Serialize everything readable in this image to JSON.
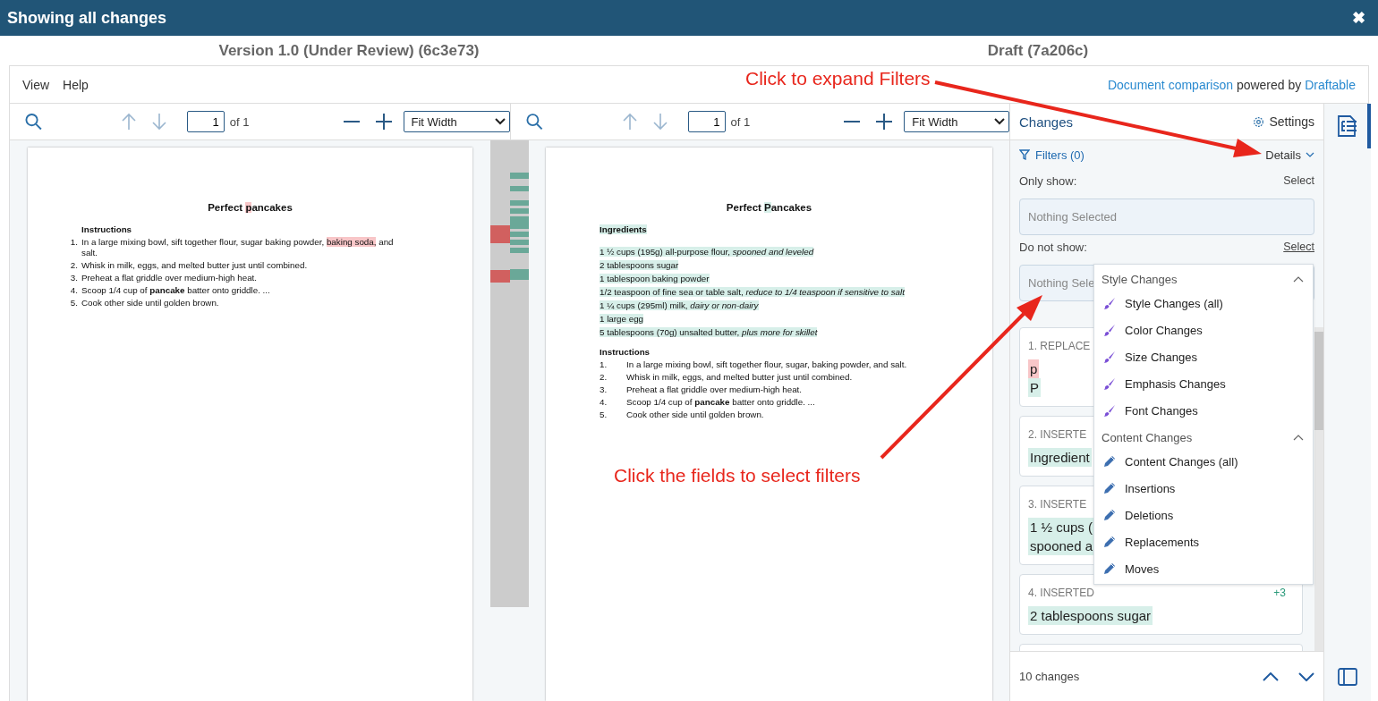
{
  "window": {
    "title": "Showing all changes",
    "close": "✖"
  },
  "versions": [
    "Version 1.0 (Under Review) (6c3e73)",
    "Draft (7a206c)"
  ],
  "menu": [
    "View",
    "Help"
  ],
  "attribution": {
    "link": "Document comparison",
    "text": " powered by ",
    "brand": "Draftable"
  },
  "panes": [
    {
      "toolbar": {
        "page": "1",
        "of": "of 1",
        "zoom": "Fit Width",
        "up_disabled": true,
        "down_disabled": true
      },
      "document": {
        "title": [
          {
            "text": "Perfect ",
            "kind": "plain"
          },
          {
            "text": "p",
            "kind": "deleted"
          },
          {
            "text": "ancakes",
            "kind": "plain"
          }
        ],
        "blocks": [
          {
            "kind": "heading",
            "segments": [
              {
                "text": "Instructions",
                "kind": "plain"
              }
            ]
          },
          {
            "kind": "list",
            "items": [
              {
                "number": "1.",
                "segments": [
                  {
                    "text": "In a large mixing bowl, sift together flour, sugar baking powder, ",
                    "kind": "plain"
                  },
                  {
                    "text": "baking soda,",
                    "kind": "deleted"
                  },
                  {
                    "text": " and salt.",
                    "kind": "plain"
                  }
                ]
              },
              {
                "number": "2.",
                "segments": [
                  {
                    "text": "Whisk in milk, eggs, and melted butter just until combined.",
                    "kind": "plain"
                  }
                ]
              },
              {
                "number": "3.",
                "segments": [
                  {
                    "text": "Preheat a flat griddle over medium-high heat.",
                    "kind": "plain"
                  }
                ]
              },
              {
                "number": "4.",
                "segments": [
                  {
                    "text": "Scoop 1/4 cup of **pancake** batter onto griddle. ...",
                    "kind": "plain"
                  }
                ]
              },
              {
                "number": "5.",
                "segments": [
                  {
                    "text": "Cook other side until golden brown.",
                    "kind": "plain"
                  }
                ]
              }
            ]
          }
        ]
      }
    },
    {
      "toolbar": {
        "page": "1",
        "of": "of 1",
        "zoom": "Fit Width",
        "up_disabled": true,
        "down_disabled": true
      },
      "document": {
        "title": [
          {
            "text": "Perfect ",
            "kind": "plain"
          },
          {
            "text": "P",
            "kind": "inserted"
          },
          {
            "text": "ancakes",
            "kind": "plain"
          }
        ],
        "blocks": [
          {
            "kind": "heading",
            "segments": [
              {
                "text": "Ingredients",
                "kind": "inserted"
              }
            ]
          },
          {
            "kind": "line",
            "segments": [
              {
                "text": "1 ½ cups (195g) all-purpose flour, *spooned and leveled*",
                "kind": "inserted"
              }
            ]
          },
          {
            "kind": "line",
            "segments": [
              {
                "text": "2 tablespoons sugar",
                "kind": "inserted"
              }
            ]
          },
          {
            "kind": "line",
            "segments": [
              {
                "text": "1 tablespoon baking powder",
                "kind": "inserted"
              }
            ]
          },
          {
            "kind": "line",
            "segments": [
              {
                "text": "1/2 teaspoon of fine sea or table salt, *reduce to 1/4 teaspoon if sensitive to salt*",
                "kind": "inserted"
              }
            ]
          },
          {
            "kind": "line",
            "segments": [
              {
                "text": "1 ¼ cups (295ml) milk, *dairy or non-dairy*",
                "kind": "inserted"
              }
            ]
          },
          {
            "kind": "line",
            "segments": [
              {
                "text": "1 large egg",
                "kind": "inserted"
              }
            ]
          },
          {
            "kind": "line",
            "segments": [
              {
                "text": "5 tablespoons (70g) unsalted butter, *plus more for skillet*",
                "kind": "inserted"
              }
            ]
          },
          {
            "kind": "heading",
            "segments": [
              {
                "text": "Instructions",
                "kind": "plain"
              }
            ]
          },
          {
            "kind": "tab-list",
            "items": [
              {
                "number": "1.",
                "segments": [
                  {
                    "text": "In a large mixing bowl, sift together flour, sugar, baking powder, and salt.",
                    "kind": "plain"
                  }
                ]
              },
              {
                "number": "2.",
                "segments": [
                  {
                    "text": "Whisk in milk, eggs, and melted butter just until combined.",
                    "kind": "plain"
                  }
                ]
              },
              {
                "number": "3.",
                "segments": [
                  {
                    "text": "Preheat a flat griddle over medium-high heat.",
                    "kind": "plain"
                  }
                ]
              },
              {
                "number": "4.",
                "segments": [
                  {
                    "text": "Scoop 1/4 cup of **pancake** batter onto griddle. ...",
                    "kind": "plain"
                  }
                ]
              },
              {
                "number": "5.",
                "segments": [
                  {
                    "text": "Cook other side until golden brown.",
                    "kind": "plain"
                  }
                ]
              }
            ]
          }
        ]
      }
    }
  ],
  "changes": {
    "title": "Changes",
    "settings": "Settings",
    "filters": "Filters (0)",
    "details": "Details",
    "only_show": {
      "label": "Only show:",
      "select": "Select",
      "placeholder": "Nothing Selected"
    },
    "do_not_show": {
      "label": "Do not show:",
      "select": "Select",
      "placeholder": "Nothing Sele"
    },
    "cards": [
      {
        "heading": "1. REPLACE",
        "lines": [
          {
            "text": "p",
            "kind": "deleted"
          },
          {
            "text": "P",
            "kind": "inserted"
          }
        ]
      },
      {
        "heading": "2. INSERTE",
        "lines": [
          {
            "text": "Ingredient",
            "kind": "inserted"
          }
        ]
      },
      {
        "heading": "3. INSERTE",
        "lines": [
          {
            "text": "1 ½ cups (",
            "kind": "inserted"
          },
          {
            "text": "spooned a",
            "kind": "inserted"
          }
        ]
      },
      {
        "heading": "4. INSERTED",
        "count": "+3",
        "lines": [
          {
            "text": "2 tablespoons sugar",
            "kind": "inserted"
          }
        ]
      }
    ],
    "count": "10 changes"
  },
  "dropdown": {
    "groups": [
      {
        "title": "Style Changes",
        "kind": "style",
        "expanded": true,
        "items": [
          "Style Changes (all)",
          "Color Changes",
          "Size Changes",
          "Emphasis Changes",
          "Font Changes"
        ]
      },
      {
        "title": "Content Changes",
        "kind": "content",
        "expanded": true,
        "items": [
          "Content Changes (all)",
          "Insertions",
          "Deletions",
          "Replacements",
          "Moves"
        ]
      }
    ]
  },
  "sidebar": [
    {
      "kind": "changes",
      "selected": true
    },
    {
      "kind": "panel",
      "selected": false
    }
  ],
  "annotations": [
    {
      "text": "Click to expand Filters"
    },
    {
      "text": "Click the fields to select filters"
    }
  ]
}
